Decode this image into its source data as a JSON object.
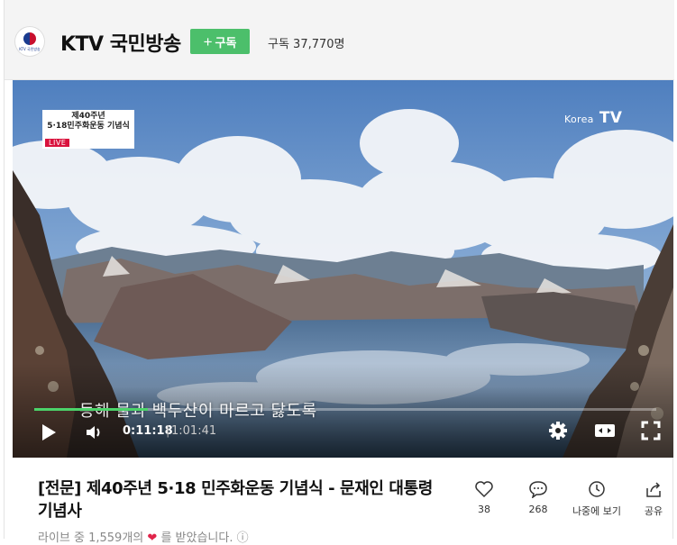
{
  "channel": {
    "logo_text": "KTV 국민방송",
    "name": "KTV 국민방송",
    "subscribe_label": "구독",
    "subscribers": "구독 37,770명"
  },
  "video": {
    "badge_line1": "제40주년",
    "badge_line2": "5·18민주화운동 기념식",
    "badge_live": "LIVE",
    "watermark_main": "Korea",
    "watermark_suffix": "TV",
    "caption": "동해 물과 백두산이 마르고 닳도록",
    "current_time": "0:11:18",
    "time_separator": "|",
    "total_time": "1:01:41",
    "progress_fraction": 0.183
  },
  "info": {
    "title": "[전문] 제40주년 5·18 민주화운동 기념식 - 문재인 대통령 기념사",
    "likes_prefix": "라이브 중 1,559개의",
    "likes_suffix": "를 받았습니다."
  },
  "actions": [
    {
      "icon": "heart-icon",
      "label": "38"
    },
    {
      "icon": "comment-icon",
      "label": "268"
    },
    {
      "icon": "clock-icon",
      "label": "나중에 보기"
    },
    {
      "icon": "share-icon",
      "label": "공유"
    }
  ],
  "colors": {
    "accent_green": "#4cbf6b",
    "progress_green": "#4cd36a",
    "live_red": "#d9123d",
    "heart_red": "#e0244a"
  }
}
